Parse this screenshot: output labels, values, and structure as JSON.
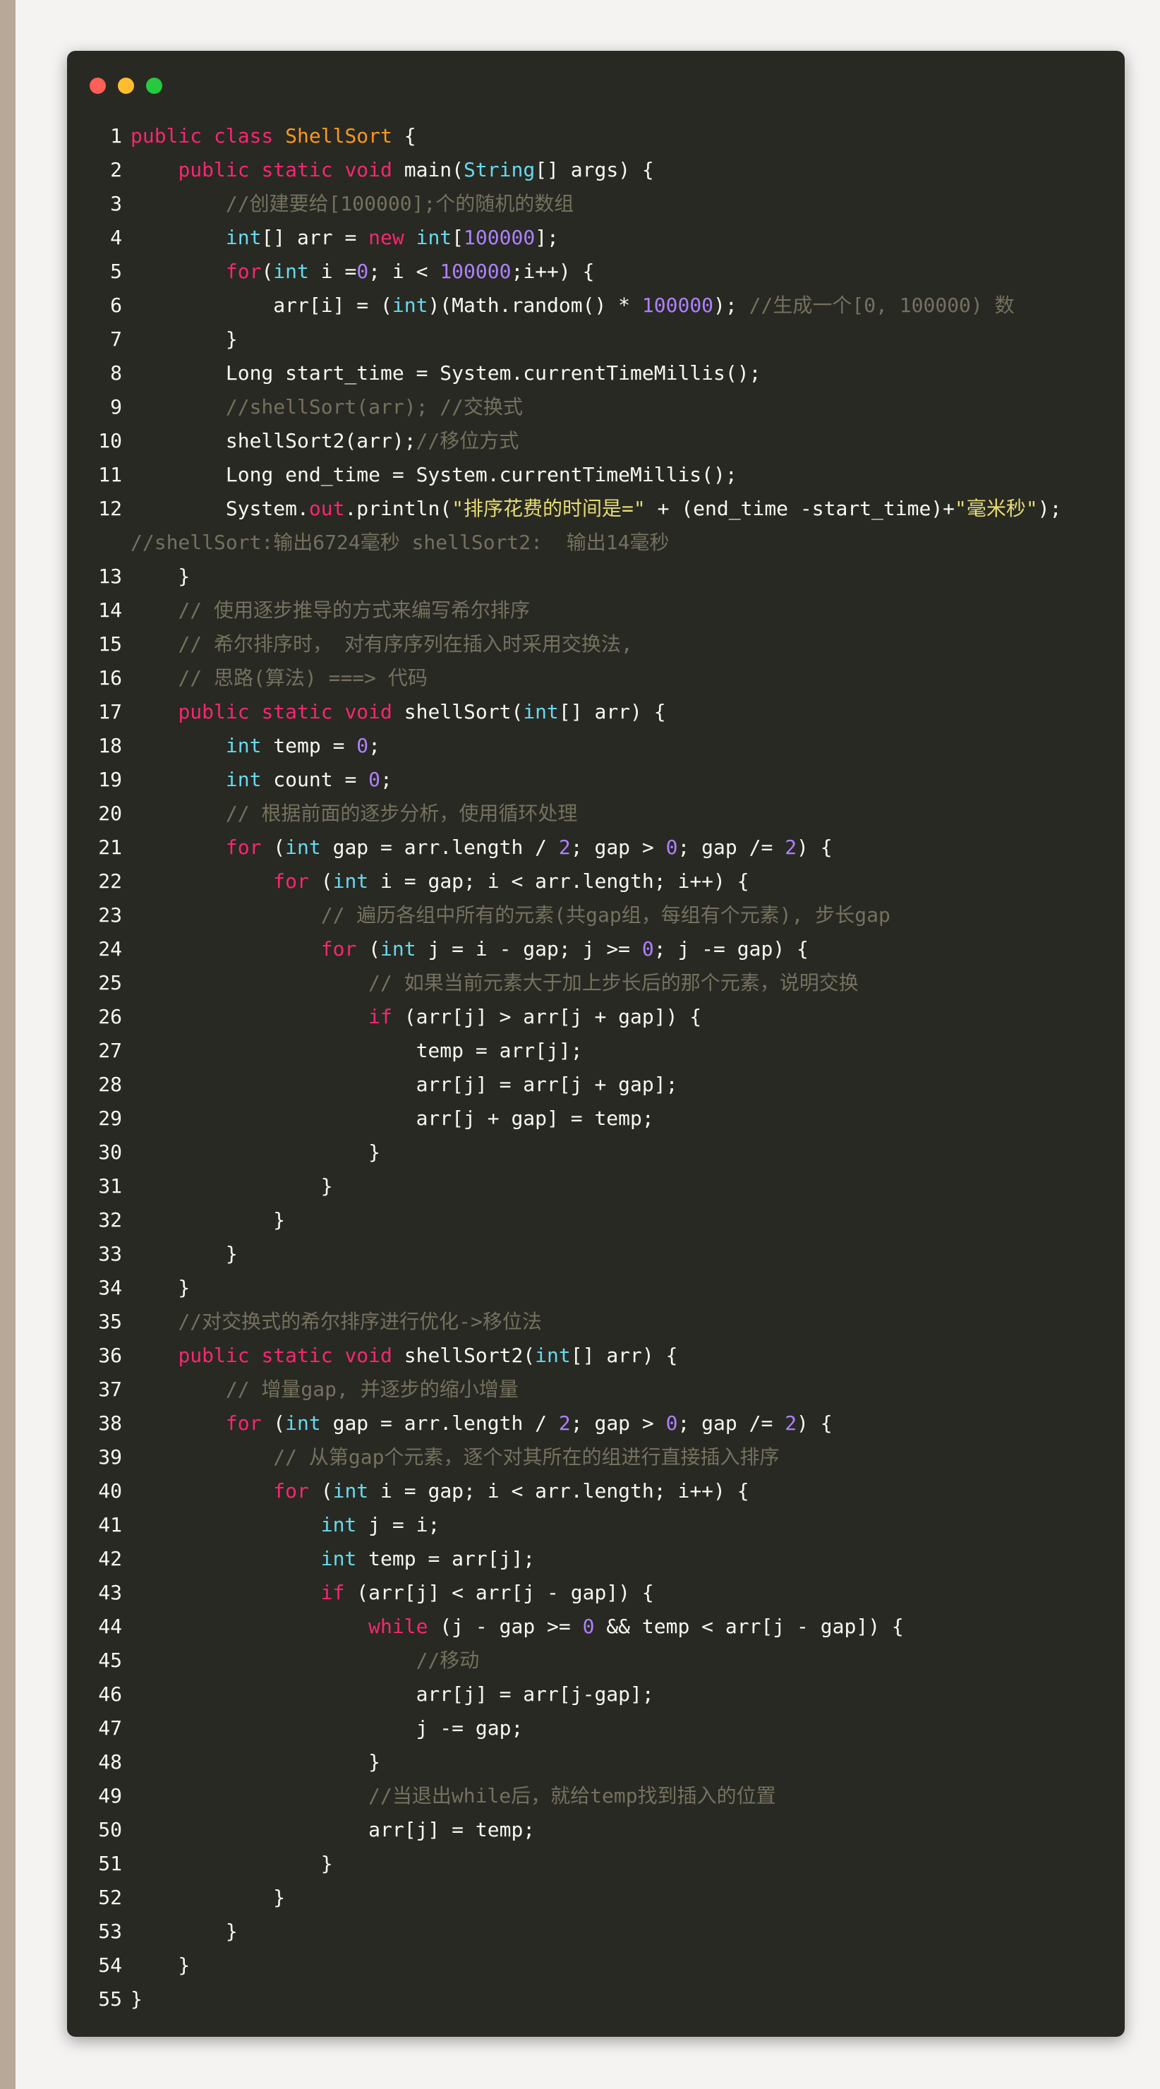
{
  "window": {
    "controls": [
      "close",
      "minimize",
      "maximize"
    ],
    "control_colors": {
      "close": "#ff5f56",
      "minimize": "#ffbd2e",
      "maximize": "#27c93f"
    },
    "background": "#282923"
  },
  "code": {
    "language": "java",
    "line_numbers": [
      "1",
      "2",
      "3",
      "4",
      "5",
      "6",
      "7",
      "8",
      "9",
      "10",
      "11",
      "12",
      "13",
      "14",
      "15",
      "16",
      "17",
      "18",
      "19",
      "20",
      "21",
      "22",
      "23",
      "24",
      "25",
      "26",
      "27",
      "28",
      "29",
      "30",
      "31",
      "32",
      "33",
      "34",
      "35",
      "36",
      "37",
      "38",
      "39",
      "40",
      "41",
      "42",
      "43",
      "44",
      "45",
      "46",
      "47",
      "48",
      "49",
      "50",
      "51",
      "52",
      "53",
      "54",
      "55"
    ],
    "lines": [
      [
        [
          "public class ",
          "kw"
        ],
        [
          "ShellSort",
          "cls"
        ],
        [
          " {",
          ""
        ]
      ],
      [
        [
          "    ",
          ""
        ],
        [
          "public static void ",
          "kw"
        ],
        [
          "main(",
          ""
        ],
        [
          "String",
          "ty"
        ],
        [
          "[] args) {",
          ""
        ]
      ],
      [
        [
          "        ",
          ""
        ],
        [
          "//创建要给[100000];个的随机的数组",
          "com"
        ]
      ],
      [
        [
          "        ",
          ""
        ],
        [
          "int",
          "ty"
        ],
        [
          "[] arr = ",
          ""
        ],
        [
          "new ",
          "kw"
        ],
        [
          "int",
          "ty"
        ],
        [
          "[",
          ""
        ],
        [
          "100000",
          "num"
        ],
        [
          "];",
          ""
        ]
      ],
      [
        [
          "        ",
          ""
        ],
        [
          "for",
          "kw"
        ],
        [
          "(",
          ""
        ],
        [
          "int",
          "ty"
        ],
        [
          " i =",
          ""
        ],
        [
          "0",
          "num"
        ],
        [
          "; i < ",
          ""
        ],
        [
          "100000",
          "num"
        ],
        [
          ";i++) {",
          ""
        ]
      ],
      [
        [
          "            arr[i] = (",
          ""
        ],
        [
          "int",
          "ty"
        ],
        [
          ")(Math.random() * ",
          ""
        ],
        [
          "100000",
          "num"
        ],
        [
          "); ",
          ""
        ],
        [
          "//生成一个[0, 100000) 数",
          "com"
        ]
      ],
      [
        [
          "        }",
          ""
        ]
      ],
      [
        [
          "        Long start_time = System.currentTimeMillis();",
          ""
        ]
      ],
      [
        [
          "        ",
          ""
        ],
        [
          "//shellSort(arr); //交换式",
          "com"
        ]
      ],
      [
        [
          "        shellSort2(arr);",
          ""
        ],
        [
          "//移位方式",
          "com"
        ]
      ],
      [
        [
          "        Long end_time = System.currentTimeMillis();",
          ""
        ]
      ],
      [
        [
          "        System.",
          ""
        ],
        [
          "out",
          "out"
        ],
        [
          ".println(",
          ""
        ],
        [
          "\"排序花费的时间是=\"",
          "str"
        ],
        [
          " + (end_time -start_time)+",
          ""
        ],
        [
          "\"毫米秒\"",
          "str"
        ],
        [
          "); ",
          ""
        ],
        [
          "//shellSort:输出6724毫秒 shellSort2:  输出14毫秒",
          "com"
        ]
      ],
      [
        [
          "    }",
          ""
        ]
      ],
      [
        [
          "    ",
          ""
        ],
        [
          "// 使用逐步推导的方式来编写希尔排序",
          "com"
        ]
      ],
      [
        [
          "    ",
          ""
        ],
        [
          "// 希尔排序时， 对有序序列在插入时采用交换法,",
          "com"
        ]
      ],
      [
        [
          "    ",
          ""
        ],
        [
          "// 思路(算法) ===> 代码",
          "com"
        ]
      ],
      [
        [
          "    ",
          ""
        ],
        [
          "public static void ",
          "kw"
        ],
        [
          "shellSort(",
          ""
        ],
        [
          "int",
          "ty"
        ],
        [
          "[] arr) {",
          ""
        ]
      ],
      [
        [
          "        ",
          ""
        ],
        [
          "int",
          "ty"
        ],
        [
          " temp = ",
          ""
        ],
        [
          "0",
          "num"
        ],
        [
          ";",
          ""
        ]
      ],
      [
        [
          "        ",
          ""
        ],
        [
          "int",
          "ty"
        ],
        [
          " count = ",
          ""
        ],
        [
          "0",
          "num"
        ],
        [
          ";",
          ""
        ]
      ],
      [
        [
          "        ",
          ""
        ],
        [
          "// 根据前面的逐步分析，使用循环处理",
          "com"
        ]
      ],
      [
        [
          "        ",
          ""
        ],
        [
          "for",
          "kw"
        ],
        [
          " (",
          ""
        ],
        [
          "int",
          "ty"
        ],
        [
          " gap = arr.length / ",
          ""
        ],
        [
          "2",
          "num"
        ],
        [
          "; gap > ",
          ""
        ],
        [
          "0",
          "num"
        ],
        [
          "; gap /= ",
          ""
        ],
        [
          "2",
          "num"
        ],
        [
          ") {",
          ""
        ]
      ],
      [
        [
          "            ",
          ""
        ],
        [
          "for",
          "kw"
        ],
        [
          " (",
          ""
        ],
        [
          "int",
          "ty"
        ],
        [
          " i = gap; i < arr.length; i++) {",
          ""
        ]
      ],
      [
        [
          "                ",
          ""
        ],
        [
          "// 遍历各组中所有的元素(共gap组，每组有个元素), 步长gap",
          "com"
        ]
      ],
      [
        [
          "                ",
          ""
        ],
        [
          "for",
          "kw"
        ],
        [
          " (",
          ""
        ],
        [
          "int",
          "ty"
        ],
        [
          " j = i - gap; j >= ",
          ""
        ],
        [
          "0",
          "num"
        ],
        [
          "; j -= gap) {",
          ""
        ]
      ],
      [
        [
          "                    ",
          ""
        ],
        [
          "// 如果当前元素大于加上步长后的那个元素，说明交换",
          "com"
        ]
      ],
      [
        [
          "                    ",
          ""
        ],
        [
          "if",
          "kw"
        ],
        [
          " (arr[j] > arr[j + gap]) {",
          ""
        ]
      ],
      [
        [
          "                        temp = arr[j];",
          ""
        ]
      ],
      [
        [
          "                        arr[j] = arr[j + gap];",
          ""
        ]
      ],
      [
        [
          "                        arr[j + gap] = temp;",
          ""
        ]
      ],
      [
        [
          "                    }",
          ""
        ]
      ],
      [
        [
          "                }",
          ""
        ]
      ],
      [
        [
          "            }",
          ""
        ]
      ],
      [
        [
          "        }",
          ""
        ]
      ],
      [
        [
          "    }",
          ""
        ]
      ],
      [
        [
          "    ",
          ""
        ],
        [
          "//对交换式的希尔排序进行优化->移位法",
          "com"
        ]
      ],
      [
        [
          "    ",
          ""
        ],
        [
          "public static void ",
          "kw"
        ],
        [
          "shellSort2(",
          ""
        ],
        [
          "int",
          "ty"
        ],
        [
          "[] arr) {",
          ""
        ]
      ],
      [
        [
          "        ",
          ""
        ],
        [
          "// 增量gap, 并逐步的缩小增量",
          "com"
        ]
      ],
      [
        [
          "        ",
          ""
        ],
        [
          "for",
          "kw"
        ],
        [
          " (",
          ""
        ],
        [
          "int",
          "ty"
        ],
        [
          " gap = arr.length / ",
          ""
        ],
        [
          "2",
          "num"
        ],
        [
          "; gap > ",
          ""
        ],
        [
          "0",
          "num"
        ],
        [
          "; gap /= ",
          ""
        ],
        [
          "2",
          "num"
        ],
        [
          ") {",
          ""
        ]
      ],
      [
        [
          "            ",
          ""
        ],
        [
          "// 从第gap个元素，逐个对其所在的组进行直接插入排序",
          "com"
        ]
      ],
      [
        [
          "            ",
          ""
        ],
        [
          "for",
          "kw"
        ],
        [
          " (",
          ""
        ],
        [
          "int",
          "ty"
        ],
        [
          " i = gap; i < arr.length; i++) {",
          ""
        ]
      ],
      [
        [
          "                ",
          ""
        ],
        [
          "int",
          "ty"
        ],
        [
          " j = i;",
          ""
        ]
      ],
      [
        [
          "                ",
          ""
        ],
        [
          "int",
          "ty"
        ],
        [
          " temp = arr[j];",
          ""
        ]
      ],
      [
        [
          "                ",
          ""
        ],
        [
          "if",
          "kw"
        ],
        [
          " (arr[j] < arr[j - gap]) {",
          ""
        ]
      ],
      [
        [
          "                    ",
          ""
        ],
        [
          "while",
          "kw"
        ],
        [
          " (j - gap >= ",
          ""
        ],
        [
          "0",
          "num"
        ],
        [
          " && temp < arr[j - gap]) {",
          ""
        ]
      ],
      [
        [
          "                        ",
          ""
        ],
        [
          "//移动",
          "com"
        ]
      ],
      [
        [
          "                        arr[j] = arr[j-gap];",
          ""
        ]
      ],
      [
        [
          "                        j -= gap;",
          ""
        ]
      ],
      [
        [
          "                    }",
          ""
        ]
      ],
      [
        [
          "                    ",
          ""
        ],
        [
          "//当退出while后，就给temp找到插入的位置",
          "com"
        ]
      ],
      [
        [
          "                    arr[j] = temp;",
          ""
        ]
      ],
      [
        [
          "                }",
          ""
        ]
      ],
      [
        [
          "            }",
          ""
        ]
      ],
      [
        [
          "        }",
          ""
        ]
      ],
      [
        [
          "    }",
          ""
        ]
      ],
      [
        [
          "}",
          ""
        ]
      ]
    ]
  }
}
